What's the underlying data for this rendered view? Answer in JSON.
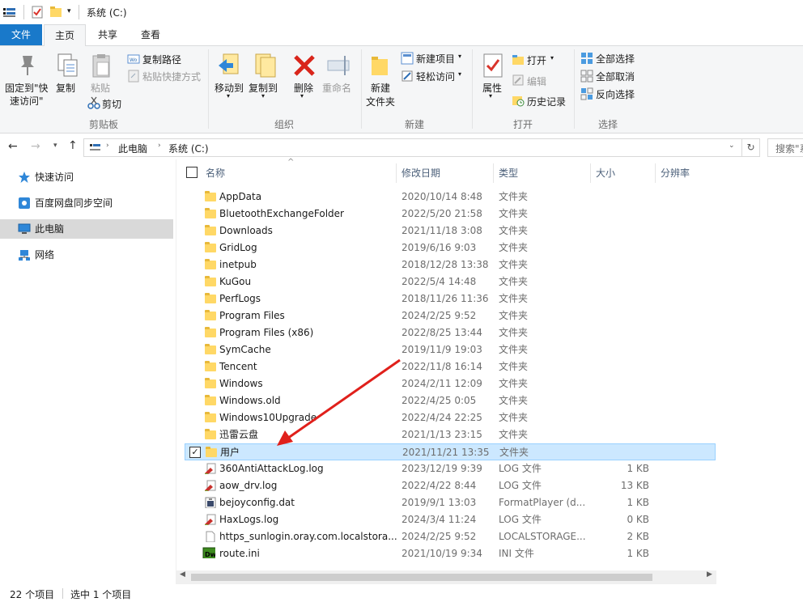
{
  "window": {
    "title": "系统 (C:)"
  },
  "tabs": [
    {
      "label": "文件"
    },
    {
      "label": "主页"
    },
    {
      "label": "共享"
    },
    {
      "label": "查看"
    }
  ],
  "ribbon": {
    "clipboard": {
      "group": "剪贴板",
      "pin_line1": "固定到\"快",
      "pin_line2": "速访问\"",
      "copy": "复制",
      "paste": "粘贴",
      "copy_path": "复制路径",
      "paste_shortcut": "粘贴快捷方式",
      "cut": "剪切"
    },
    "organize": {
      "group": "组织",
      "move_to": "移动到",
      "copy_to": "复制到",
      "delete": "删除",
      "rename": "重命名"
    },
    "new": {
      "group": "新建",
      "new_folder_line1": "新建",
      "new_folder_line2": "文件夹",
      "new_item": "新建项目",
      "easy_access": "轻松访问"
    },
    "open": {
      "group": "打开",
      "properties": "属性",
      "open": "打开",
      "edit": "编辑",
      "history": "历史记录"
    },
    "select": {
      "group": "选择",
      "select_all": "全部选择",
      "select_none": "全部取消",
      "invert": "反向选择"
    }
  },
  "address": {
    "crumb1": "此电脑",
    "crumb2": "系统 (C:)",
    "search_placeholder": "搜索\"系"
  },
  "nav": [
    {
      "label": "快速访问"
    },
    {
      "label": "百度网盘同步空间"
    },
    {
      "label": "此电脑"
    },
    {
      "label": "网络"
    }
  ],
  "columns": {
    "name": "名称",
    "date": "修改日期",
    "type": "类型",
    "size": "大小",
    "resolution": "分辨率"
  },
  "files": [
    {
      "name": "AppData",
      "date": "2020/10/14 8:48",
      "type": "文件夹",
      "size": "",
      "kind": "folder"
    },
    {
      "name": "BluetoothExchangeFolder",
      "date": "2022/5/20 21:58",
      "type": "文件夹",
      "size": "",
      "kind": "folder"
    },
    {
      "name": "Downloads",
      "date": "2021/11/18 3:08",
      "type": "文件夹",
      "size": "",
      "kind": "folder"
    },
    {
      "name": "GridLog",
      "date": "2019/6/16 9:03",
      "type": "文件夹",
      "size": "",
      "kind": "folder"
    },
    {
      "name": "inetpub",
      "date": "2018/12/28 13:38",
      "type": "文件夹",
      "size": "",
      "kind": "folder"
    },
    {
      "name": "KuGou",
      "date": "2022/5/4 14:48",
      "type": "文件夹",
      "size": "",
      "kind": "folder"
    },
    {
      "name": "PerfLogs",
      "date": "2018/11/26 11:36",
      "type": "文件夹",
      "size": "",
      "kind": "folder"
    },
    {
      "name": "Program Files",
      "date": "2024/2/25 9:52",
      "type": "文件夹",
      "size": "",
      "kind": "folder"
    },
    {
      "name": "Program Files (x86)",
      "date": "2022/8/25 13:44",
      "type": "文件夹",
      "size": "",
      "kind": "folder"
    },
    {
      "name": "SymCache",
      "date": "2019/11/9 19:03",
      "type": "文件夹",
      "size": "",
      "kind": "folder"
    },
    {
      "name": "Tencent",
      "date": "2022/11/8 16:14",
      "type": "文件夹",
      "size": "",
      "kind": "folder"
    },
    {
      "name": "Windows",
      "date": "2024/2/11 12:09",
      "type": "文件夹",
      "size": "",
      "kind": "folder"
    },
    {
      "name": "Windows.old",
      "date": "2022/4/25 0:05",
      "type": "文件夹",
      "size": "",
      "kind": "folder"
    },
    {
      "name": "Windows10Upgrade",
      "date": "2022/4/24 22:25",
      "type": "文件夹",
      "size": "",
      "kind": "folder"
    },
    {
      "name": "迅雷云盘",
      "date": "2021/1/13 23:15",
      "type": "文件夹",
      "size": "",
      "kind": "folder"
    },
    {
      "name": "用户",
      "date": "2021/11/21 13:35",
      "type": "文件夹",
      "size": "",
      "kind": "folder"
    },
    {
      "name": "360AntiAttackLog.log",
      "date": "2023/12/19 9:39",
      "type": "LOG 文件",
      "size": "1 KB",
      "kind": "log"
    },
    {
      "name": "aow_drv.log",
      "date": "2022/4/22 8:44",
      "type": "LOG 文件",
      "size": "13 KB",
      "kind": "log"
    },
    {
      "name": "bejoyconfig.dat",
      "date": "2019/9/1 13:03",
      "type": "FormatPlayer (d...",
      "size": "1 KB",
      "kind": "dat"
    },
    {
      "name": "HaxLogs.log",
      "date": "2024/3/4 11:24",
      "type": "LOG 文件",
      "size": "0 KB",
      "kind": "log"
    },
    {
      "name": "https_sunlogin.oray.com.localstora...",
      "date": "2024/2/25 9:52",
      "type": "LOCALSTORAGE...",
      "size": "2 KB",
      "kind": "blank"
    },
    {
      "name": "route.ini",
      "date": "2021/10/19 9:34",
      "type": "INI 文件",
      "size": "1 KB",
      "kind": "dw"
    }
  ],
  "status": {
    "count": "22 个项目",
    "selected": "选中 1 个项目"
  },
  "colors": {
    "accent": "#1979ca",
    "selection": "#cce8ff",
    "annotation_arrow": "#e0201b"
  }
}
